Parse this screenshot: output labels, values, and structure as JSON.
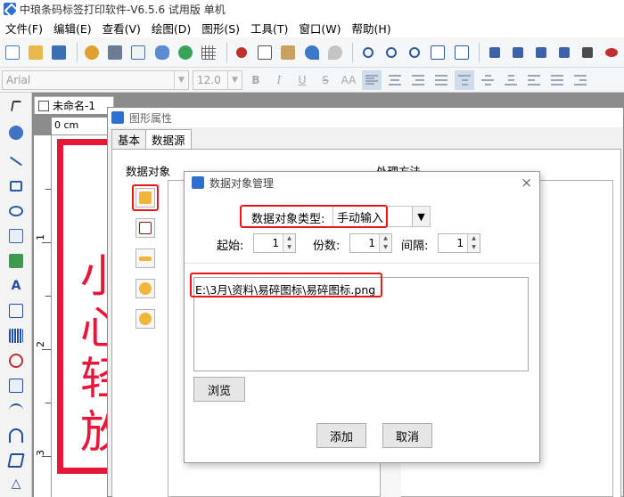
{
  "window": {
    "title": "中琅条码标签打印软件-V6.5.6 试用版 单机"
  },
  "menu": [
    {
      "label": "文件(F)"
    },
    {
      "label": "编辑(E)"
    },
    {
      "label": "查看(V)"
    },
    {
      "label": "绘图(D)"
    },
    {
      "label": "图形(S)"
    },
    {
      "label": "工具(T)"
    },
    {
      "label": "窗口(W)"
    },
    {
      "label": "帮助(H)"
    }
  ],
  "format_bar": {
    "font": "Arial",
    "size": "12.0",
    "bold": "B",
    "italic": "I",
    "underline": "U",
    "strike": "S",
    "kerning": "AA"
  },
  "document": {
    "tab": "未命名-1",
    "ruler_unit": "0 cm",
    "ruler_numbers": [
      "1",
      "2",
      "3"
    ],
    "label_chars": [
      "小",
      "心",
      "轻",
      "放"
    ]
  },
  "props_dialog": {
    "title": "图形属性",
    "tabs": [
      {
        "label": "基本"
      },
      {
        "label": "数据源"
      }
    ],
    "group_data_object": "数据对象",
    "group_process": "处理方法"
  },
  "data_dialog": {
    "title": "数据对象管理",
    "close": "×",
    "type_label": "数据对象类型:",
    "type_value": "手动输入",
    "start_label": "起始:",
    "start_value": "1",
    "count_label": "份数:",
    "count_value": "1",
    "interval_label": "间隔:",
    "interval_value": "1",
    "path_value": "E:\\3月\\资料\\易碎图标\\易碎图标.png",
    "browse": "浏览",
    "add": "添加",
    "cancel": "取消"
  },
  "colors": {
    "accent_red": "#e81818",
    "label_red": "#e8173a",
    "app_blue": "#2f6fd0"
  }
}
